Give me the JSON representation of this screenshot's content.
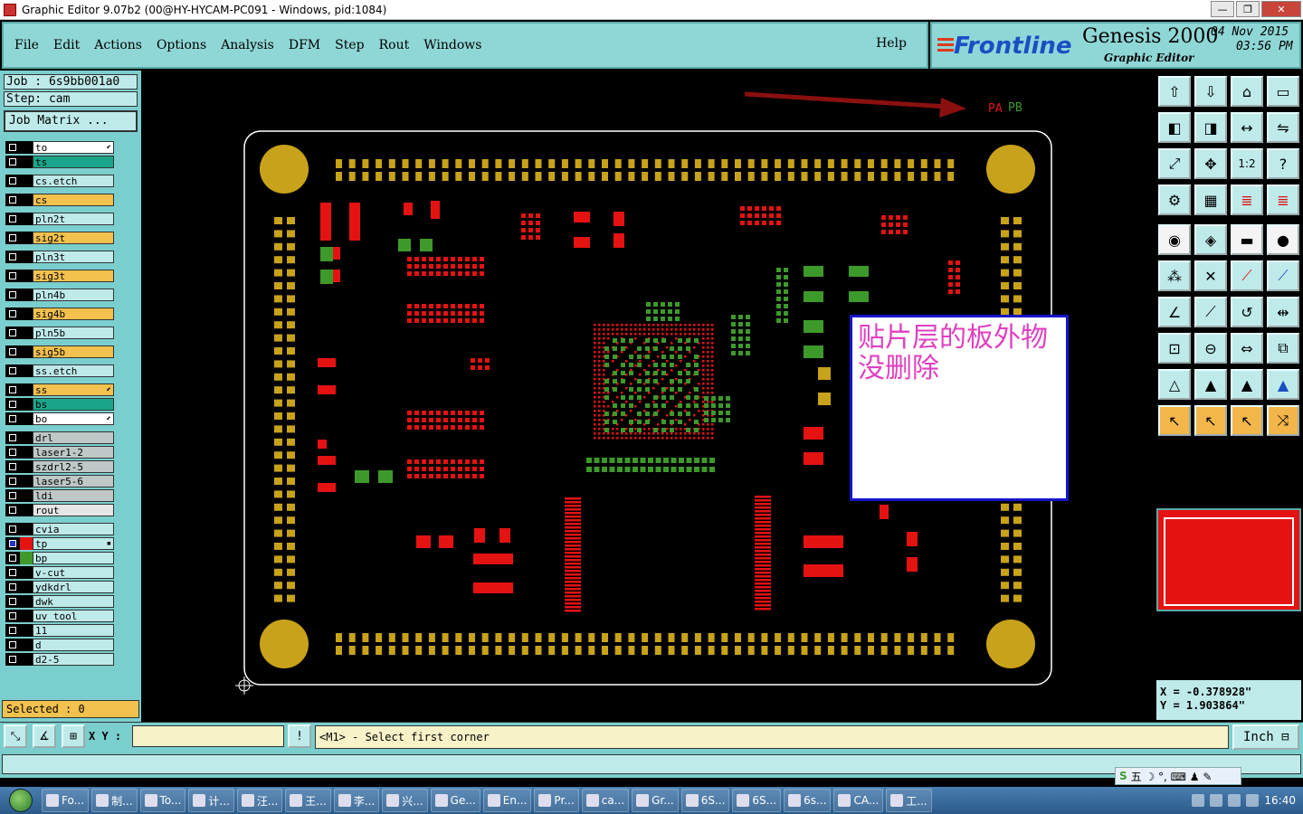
{
  "window": {
    "title": "Graphic Editor 9.07b2 (00@HY-HYCAM-PC091 - Windows, pid:1084)",
    "minimize": "—",
    "restore": "❐",
    "close": "✕"
  },
  "menu": {
    "items": [
      "File",
      "Edit",
      "Actions",
      "Options",
      "Analysis",
      "DFM",
      "Step",
      "Rout",
      "Windows"
    ],
    "help": "Help"
  },
  "brand": {
    "logo": "Frontline",
    "product": "Genesis 2000",
    "subtitle": "Graphic Editor",
    "date": "04 Nov 2015",
    "time": "03:56 PM"
  },
  "job": {
    "job_label": "Job  : 6s9bb001a0",
    "step_label": "Step: cam",
    "matrix_button": "Job Matrix ..."
  },
  "layers": [
    {
      "name": "to",
      "bg": "#ffffff",
      "color": "#000000",
      "mark": "⬋"
    },
    {
      "name": "ts",
      "bg": "#1aa58a",
      "color": "#000000",
      "mark": ""
    },
    {
      "name": "cs.etch",
      "bg": "#bfeaea",
      "color": "#000000",
      "mark": ""
    },
    {
      "name": "cs",
      "bg": "#f2c14e",
      "color": "#000000",
      "mark": ""
    },
    {
      "name": "pln2t",
      "bg": "#bfeaea",
      "color": "#000000",
      "mark": ""
    },
    {
      "name": "sig2t",
      "bg": "#f2c14e",
      "color": "#000000",
      "mark": ""
    },
    {
      "name": "pln3t",
      "bg": "#bfeaea",
      "color": "#000000",
      "mark": ""
    },
    {
      "name": "sig3t",
      "bg": "#f2c14e",
      "color": "#000000",
      "mark": ""
    },
    {
      "name": "pln4b",
      "bg": "#bfeaea",
      "color": "#000000",
      "mark": ""
    },
    {
      "name": "sig4b",
      "bg": "#f2c14e",
      "color": "#000000",
      "mark": ""
    },
    {
      "name": "pln5b",
      "bg": "#bfeaea",
      "color": "#000000",
      "mark": ""
    },
    {
      "name": "sig5b",
      "bg": "#f2c14e",
      "color": "#000000",
      "mark": ""
    },
    {
      "name": "ss.etch",
      "bg": "#bfeaea",
      "color": "#000000",
      "mark": ""
    },
    {
      "name": "ss",
      "bg": "#f2c14e",
      "color": "#000000",
      "mark": "⬋"
    },
    {
      "name": "bs",
      "bg": "#1aa58a",
      "color": "#000000",
      "mark": ""
    },
    {
      "name": "bo",
      "bg": "#ffffff",
      "color": "#000000",
      "mark": "⬋"
    },
    {
      "name": "drl",
      "bg": "#bfc7c7",
      "color": "#000000",
      "mark": ""
    },
    {
      "name": "laser1-2",
      "bg": "#bfc7c7",
      "color": "#000000",
      "mark": ""
    },
    {
      "name": "szdrl2-5",
      "bg": "#bfc7c7",
      "color": "#000000",
      "mark": ""
    },
    {
      "name": "laser5-6",
      "bg": "#bfc7c7",
      "color": "#000000",
      "mark": ""
    },
    {
      "name": "ldi",
      "bg": "#bfc7c7",
      "color": "#000000",
      "mark": ""
    },
    {
      "name": "rout",
      "bg": "#e6e6e6",
      "color": "#000000",
      "mark": ""
    },
    {
      "name": "cvia",
      "bg": "#bfeaea",
      "color": "#000000",
      "mark": ""
    },
    {
      "name": "tp",
      "bg": "#bfeaea",
      "color": "#000000",
      "mark": "▪"
    },
    {
      "name": "bp",
      "bg": "#bfeaea",
      "color": "#000000",
      "mark": ""
    },
    {
      "name": "v-cut",
      "bg": "#bfeaea",
      "color": "#000000",
      "mark": ""
    },
    {
      "name": "ydkdrl",
      "bg": "#bfeaea",
      "color": "#000000",
      "mark": ""
    },
    {
      "name": "dwk",
      "bg": "#bfeaea",
      "color": "#000000",
      "mark": ""
    },
    {
      "name": "uv_tool",
      "bg": "#bfeaea",
      "color": "#000000",
      "mark": ""
    },
    {
      "name": "11",
      "bg": "#bfeaea",
      "color": "#000000",
      "mark": ""
    },
    {
      "name": "d",
      "bg": "#bfeaea",
      "color": "#000000",
      "mark": ""
    },
    {
      "name": "d2-5",
      "bg": "#bfeaea",
      "color": "#000000",
      "mark": ""
    }
  ],
  "selected": "Selected : 0",
  "canvas": {
    "pa_label": "PA",
    "pb_label": "PB",
    "annotation": "贴片层的板外物没删除",
    "colors": {
      "pad_red": "#e51212",
      "pad_green": "#3d9a2a",
      "pad_gold": "#c8a21a",
      "outline": "#ffffff",
      "arrow": "#8a1010"
    }
  },
  "toolbar": {
    "icons": [
      "home-up-icon",
      "home-down-icon",
      "house-icon",
      "window-split-icon",
      "arrow-left-icon",
      "arrow-right-icon",
      "zoom-fit-h-icon",
      "zoom-fit-s-icon",
      "fit-screen-icon",
      "center-icon",
      "one-to-two-icon",
      "help-query-icon",
      "layers-config-icon",
      "grid-icon",
      "layer-view-red-icon",
      "layer-view-red2-icon",
      "pad-icon",
      "shape-edit-icon",
      "ruler-icon",
      "filled-circle-icon",
      "node-icon",
      "cross-icon",
      "line-red-icon",
      "line-blue-icon",
      "angle-icon",
      "diag-line-icon",
      "arc-icon",
      "split-icon",
      "snap-icon",
      "line-break-icon",
      "measure-icon",
      "group-icon",
      "triangle-icon",
      "triangle-arrow-icon",
      "triangle-a-icon",
      "triangle-blue-icon",
      "select-arrow-icon",
      "select-arrow-box-icon",
      "select-circle-icon",
      "route-icon"
    ],
    "one_to_two": "1:2",
    "query": "?"
  },
  "coords": {
    "x": "X  =  -0.378928\"",
    "y": "Y  =  1.903864\""
  },
  "bottom": {
    "xy_label": "X Y :",
    "xy_value": "",
    "alert": "!",
    "prompt": "<M1> - Select first corner",
    "unit": "Inch"
  },
  "ime": {
    "text": "五 ☽ °, ⌨ ♟ ✎"
  },
  "taskbar": {
    "tasks": [
      "Fo...",
      "制...",
      "To...",
      "计...",
      "汪...",
      "王...",
      "李...",
      "兴...",
      "Ge...",
      "En...",
      "Pr...",
      "ca...",
      "Gr...",
      "6S...",
      "6S...",
      "6s...",
      "CA...",
      "工..."
    ],
    "clock": "16:40"
  }
}
